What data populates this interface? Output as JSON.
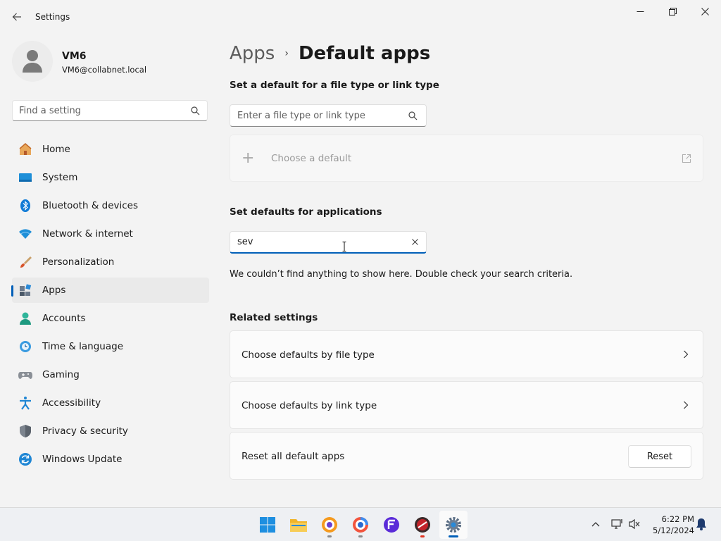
{
  "window": {
    "title": "Settings"
  },
  "user": {
    "name": "VM6",
    "email": "VM6@collabnet.local"
  },
  "sidebar": {
    "search_placeholder": "Find a setting",
    "items": [
      {
        "label": "Home",
        "icon": "home-icon"
      },
      {
        "label": "System",
        "icon": "system-icon"
      },
      {
        "label": "Bluetooth & devices",
        "icon": "bluetooth-icon"
      },
      {
        "label": "Network & internet",
        "icon": "wifi-icon"
      },
      {
        "label": "Personalization",
        "icon": "brush-icon"
      },
      {
        "label": "Apps",
        "icon": "apps-icon",
        "active": true
      },
      {
        "label": "Accounts",
        "icon": "accounts-icon"
      },
      {
        "label": "Time & language",
        "icon": "clock-globe-icon"
      },
      {
        "label": "Gaming",
        "icon": "controller-icon"
      },
      {
        "label": "Accessibility",
        "icon": "accessibility-icon"
      },
      {
        "label": "Privacy & security",
        "icon": "shield-icon"
      },
      {
        "label": "Windows Update",
        "icon": "update-icon"
      }
    ]
  },
  "breadcrumb": {
    "parent": "Apps",
    "separator": "›",
    "current": "Default apps"
  },
  "file_type_section": {
    "heading": "Set a default for a file type or link type",
    "search_placeholder": "Enter a file type or link type",
    "choose_default_label": "Choose a default"
  },
  "applications_section": {
    "heading": "Set defaults for applications",
    "search_value": "sev",
    "empty_message": "We couldn’t find anything to show here. Double check your search criteria."
  },
  "related": {
    "heading": "Related settings",
    "by_file_type": "Choose defaults by file type",
    "by_link_type": "Choose defaults by link type",
    "reset_label": "Reset all default apps",
    "reset_button": "Reset"
  },
  "taskbar": {
    "time": "6:22 PM",
    "date": "5/12/2024"
  },
  "colors": {
    "accent": "#005fb8",
    "window_bg": "#f3f3f3",
    "card_bg": "#fbfbfb"
  }
}
